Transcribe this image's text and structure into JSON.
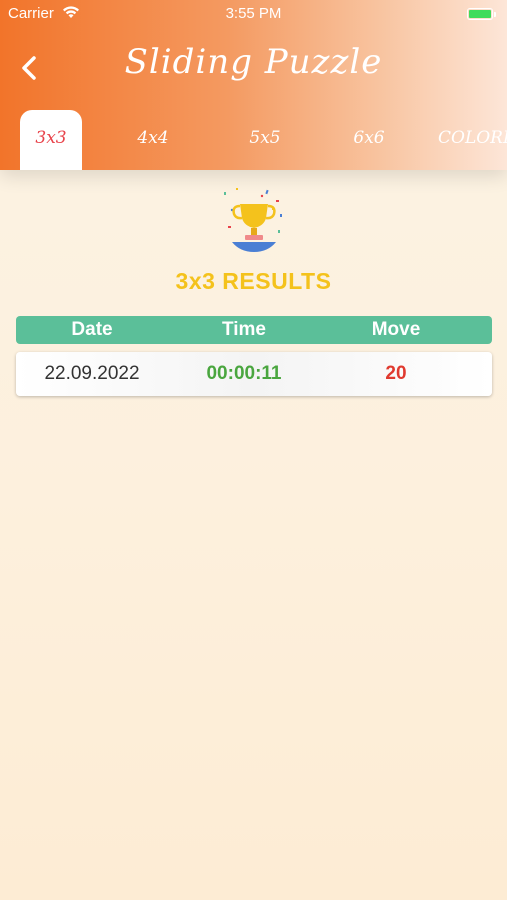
{
  "status_bar": {
    "carrier": "Carrier",
    "time": "3:55 PM"
  },
  "header": {
    "title": "Sliding Puzzle",
    "back_icon": "chevron-left-icon"
  },
  "tabs": [
    {
      "label": "3x3",
      "active": true
    },
    {
      "label": "4x4",
      "active": false
    },
    {
      "label": "5x5",
      "active": false
    },
    {
      "label": "6x6",
      "active": false
    },
    {
      "label": "COLORED",
      "active": false
    }
  ],
  "results": {
    "title": "3x3 RESULTS",
    "icon": "trophy-icon",
    "columns": [
      "Date",
      "Time",
      "Move"
    ],
    "rows": [
      {
        "date": "22.09.2022",
        "time": "00:00:11",
        "move": "20"
      }
    ]
  },
  "colors": {
    "accent_orange": "#f2742a",
    "table_header": "#5bbf99",
    "results_title": "#f4c21c",
    "active_tab_text": "#e8424a",
    "time_value": "#4aa63f",
    "move_value": "#e03a2f"
  }
}
